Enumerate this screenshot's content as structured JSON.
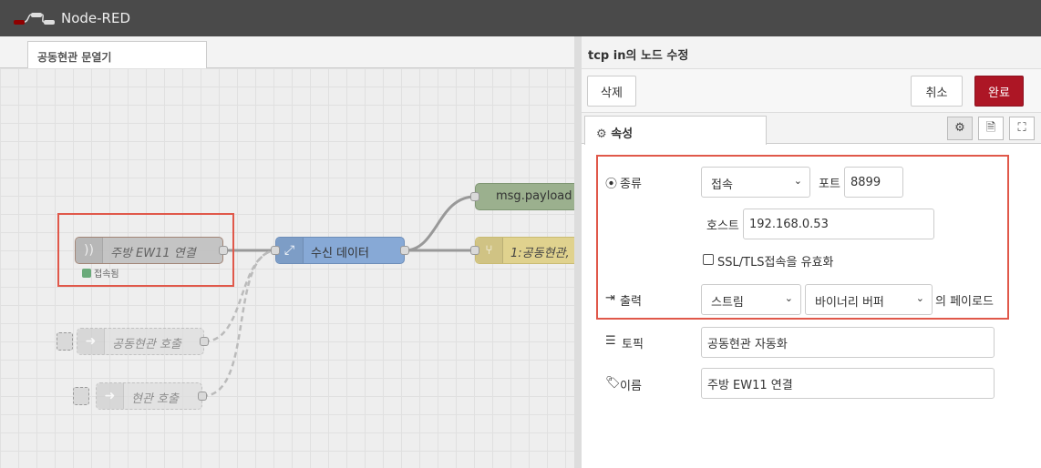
{
  "app": {
    "title": "Node-RED"
  },
  "workspace": {
    "tab_label": "공동현관 문열기",
    "nodes": {
      "tcp_in": "주방 EW11 연결",
      "tcp_status": "접속됨",
      "receive": "수신 데이터",
      "debug": "msg.payload",
      "switch": "1:공동현관,",
      "call1": "공동현관 호출",
      "call2": "현관 호출"
    }
  },
  "panel": {
    "title": "tcp in의 노드 수정",
    "delete_label": "삭제",
    "cancel_label": "취소",
    "done_label": "완료",
    "props_tab": "속성",
    "form": {
      "type_label": "종류",
      "type_value": "접속",
      "port_label": "포트",
      "port_value": "8899",
      "host_label": "호스트",
      "host_value": "192.168.0.53",
      "ssl_label": "SSL/TLS접속을 유효화",
      "output_label": "출력",
      "output_value": "스트림",
      "payload_type": "바이너리 버퍼",
      "payload_suffix": "의 페이로드",
      "topic_label": "토픽",
      "topic_value": "공동현관 자동화",
      "name_label": "이름",
      "name_value": "주방 EW11 연결"
    }
  },
  "colors": {
    "accent": "#ad1625",
    "highlight": "#e0584a"
  }
}
